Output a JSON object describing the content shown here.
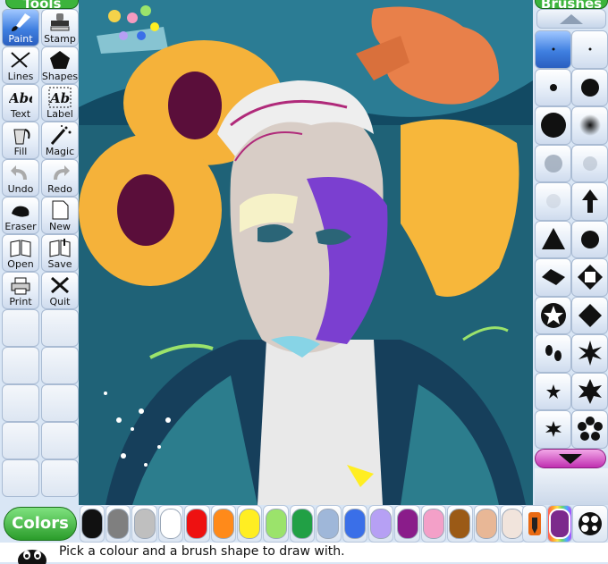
{
  "tools_panel": {
    "title": "Tools",
    "tools": [
      {
        "id": "paint",
        "label": "Paint",
        "icon": "paintbrush-icon",
        "active": true
      },
      {
        "id": "stamp",
        "label": "Stamp",
        "icon": "stamp-icon"
      },
      {
        "id": "lines",
        "label": "Lines",
        "icon": "lines-icon"
      },
      {
        "id": "shapes",
        "label": "Shapes",
        "icon": "pentagon-icon"
      },
      {
        "id": "text",
        "label": "Text",
        "icon": "text-abc-icon",
        "glyph": "Abc"
      },
      {
        "id": "label",
        "label": "Label",
        "icon": "label-abc-icon",
        "glyph": "Ab"
      },
      {
        "id": "fill",
        "label": "Fill",
        "icon": "paint-bucket-icon"
      },
      {
        "id": "magic",
        "label": "Magic",
        "icon": "magic-wand-icon"
      },
      {
        "id": "undo",
        "label": "Undo",
        "icon": "undo-icon"
      },
      {
        "id": "redo",
        "label": "Redo",
        "icon": "redo-icon"
      },
      {
        "id": "eraser",
        "label": "Eraser",
        "icon": "eraser-icon"
      },
      {
        "id": "new",
        "label": "New",
        "icon": "new-document-icon"
      },
      {
        "id": "open",
        "label": "Open",
        "icon": "open-book-icon"
      },
      {
        "id": "save",
        "label": "Save",
        "icon": "save-book-icon"
      },
      {
        "id": "print",
        "label": "Print",
        "icon": "printer-icon"
      },
      {
        "id": "quit",
        "label": "Quit",
        "icon": "quit-x-icon"
      }
    ]
  },
  "brushes_panel": {
    "title": "Brushes",
    "brushes": [
      {
        "shape": "tiny-dot",
        "active": true
      },
      {
        "shape": "tiny-dot"
      },
      {
        "shape": "small-dot"
      },
      {
        "shape": "medium-dot"
      },
      {
        "shape": "large-dot"
      },
      {
        "shape": "fuzzy-dot"
      },
      {
        "shape": "soft-gray-dot"
      },
      {
        "shape": "soft-gray-dot-2"
      },
      {
        "shape": "soft-gray-faint"
      },
      {
        "shape": "arrow-up"
      },
      {
        "shape": "triangle"
      },
      {
        "shape": "medium-dot"
      },
      {
        "shape": "diamond-flat"
      },
      {
        "shape": "square-outline"
      },
      {
        "shape": "star-outline-circle"
      },
      {
        "shape": "diamond"
      },
      {
        "shape": "footprints"
      },
      {
        "shape": "star-8"
      },
      {
        "shape": "small-star"
      },
      {
        "shape": "star-6"
      },
      {
        "shape": "small-star-6"
      },
      {
        "shape": "flower"
      }
    ]
  },
  "colors": {
    "button_label": "Colors",
    "palette": [
      "#111111",
      "#7f7f7f",
      "#bfbfbf",
      "#ffffff",
      "#ee1111",
      "#ff8a1a",
      "#ffee22",
      "#9be36b",
      "#21a045",
      "#9fb7d9",
      "#3a6fe8",
      "#b6a0f4",
      "#8a1c8a",
      "#f3a0c8",
      "#9b5a16",
      "#e8b796",
      "#f1e4dc"
    ],
    "picker_icon": "eyedropper-icon",
    "rainbow_icon": "rainbow-icon",
    "mixer_icon": "color-mixer-icon"
  },
  "status": {
    "message": "Pick a colour and a brush shape to draw with.",
    "mascot_icon": "tux-penguin-icon"
  },
  "canvas": {
    "description_icon": "painting-canvas"
  }
}
